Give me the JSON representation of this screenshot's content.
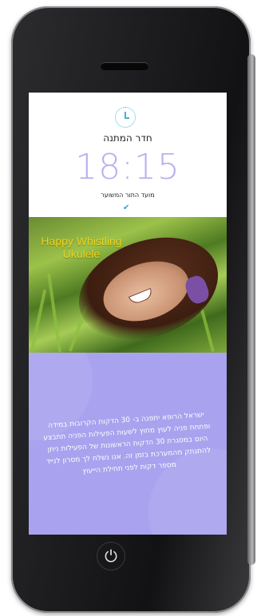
{
  "header": {
    "clock_icon": "clock-icon",
    "room_title": "חדר המתנה",
    "time": "18:15",
    "subtitle": "מועד התור המשוער",
    "check_icon": "check-icon"
  },
  "media": {
    "title": "Happy Whistling Ukulele"
  },
  "info": {
    "text": "ישראל הרופא יתפנה ב- 30 הדקות הקרובות במידה ופתחת פניה לעוץ מחוץ לשעות הפעילות הפניה תתבצע היום במסגרת 30 הדקות הראשונות של הפעילות ניתן להתנתק מהמערכת בזמן זה. אנו נשלח לך מסרון לנייד מספר דקות לפני תחילת הייעוץ",
    "background_color": "#a9a2ee"
  },
  "device": {
    "home_button_icon": "power-icon",
    "home_button_glyph": "⏻",
    "accent_color": "#3fb6d8",
    "time_color": "#b7b2ef",
    "media_title_color": "#f1d31b"
  }
}
